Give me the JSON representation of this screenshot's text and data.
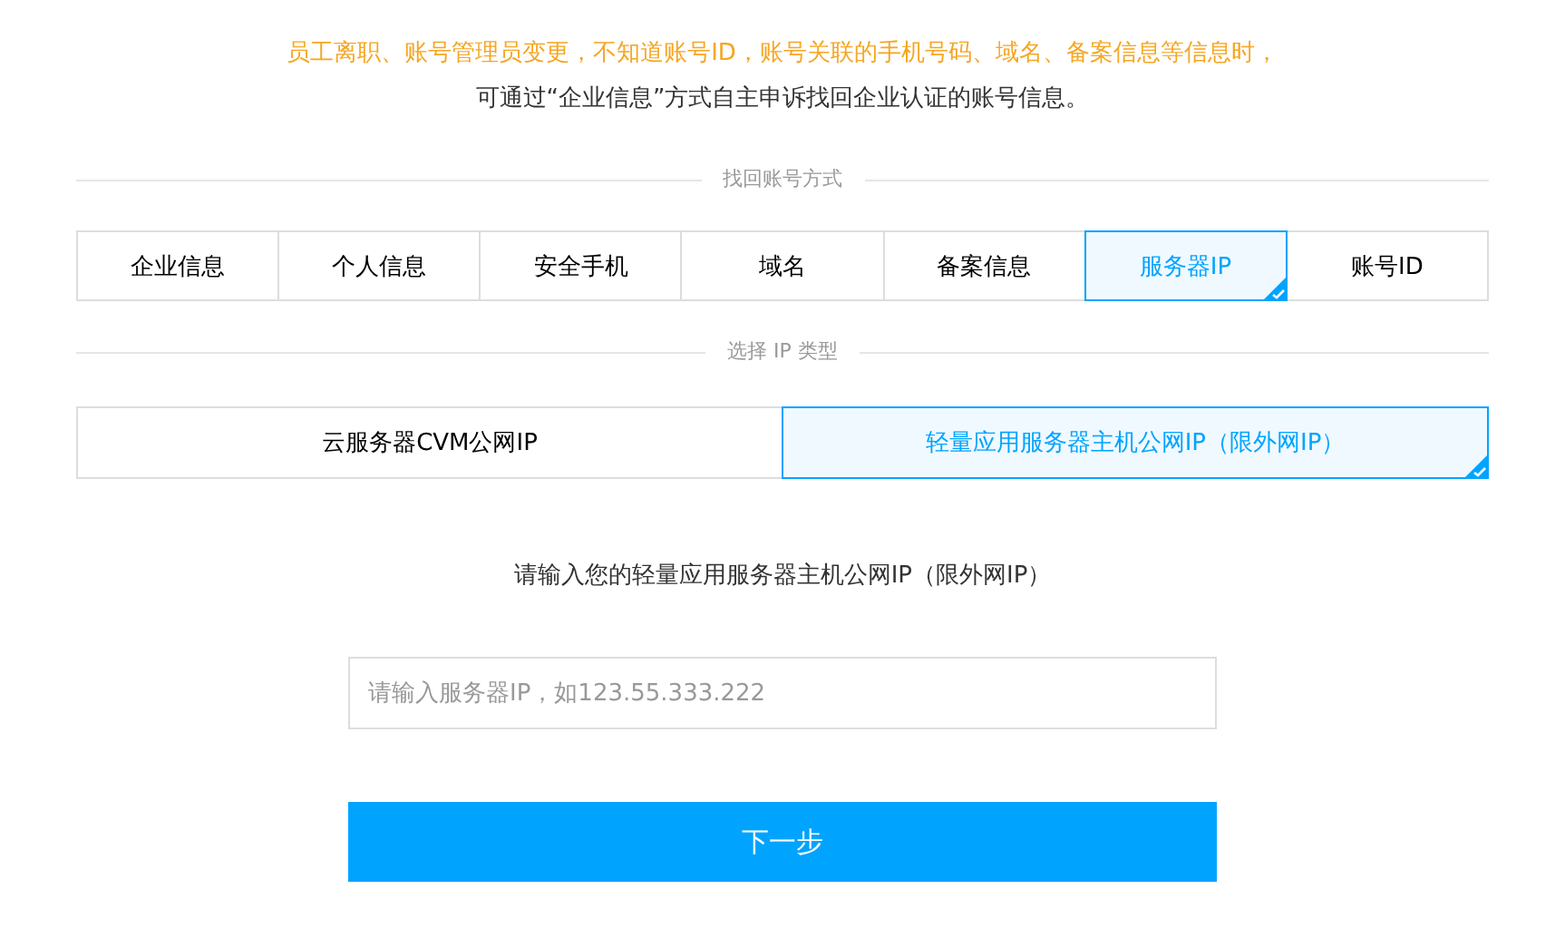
{
  "notice": {
    "warning": "员工离职、账号管理员变更，不知道账号ID，账号关联的手机号码、域名、备案信息等信息时，",
    "hint": "可通过“企业信息”方式自主申诉找回企业认证的账号信息。"
  },
  "method_divider": "找回账号方式",
  "methods": [
    {
      "label": "企业信息",
      "selected": false
    },
    {
      "label": "个人信息",
      "selected": false
    },
    {
      "label": "安全手机",
      "selected": false
    },
    {
      "label": "域名",
      "selected": false
    },
    {
      "label": "备案信息",
      "selected": false
    },
    {
      "label": "服务器IP",
      "selected": true
    },
    {
      "label": "账号ID",
      "selected": false
    }
  ],
  "ip_divider": "选择 IP 类型",
  "ip_types": [
    {
      "label": "云服务器CVM公网IP",
      "selected": false
    },
    {
      "label": "轻量应用服务器主机公网IP（限外网IP）",
      "selected": true
    }
  ],
  "prompt": "请输入您的轻量应用服务器主机公网IP（限外网IP）",
  "ip_field": {
    "placeholder": "请输入服务器IP，如123.55.333.222"
  },
  "next_button": "下一步"
}
